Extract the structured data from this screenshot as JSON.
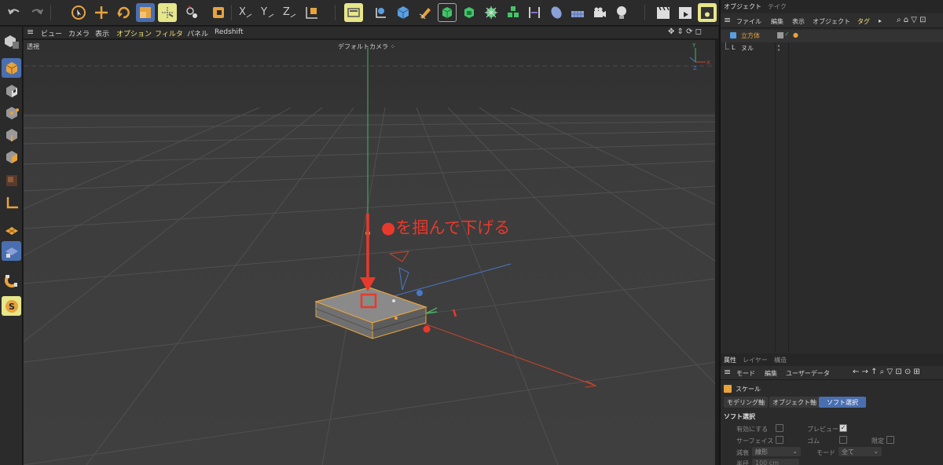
{
  "viewport_menu": {
    "items": [
      "ビュー",
      "カメラ",
      "表示",
      "オプション",
      "フィルタ",
      "パネル",
      "Redshift"
    ]
  },
  "viewport": {
    "projection": "透視",
    "camera": "デフォルトカメラ",
    "annotation": "●を掴んで下げる"
  },
  "object_manager": {
    "tabs": [
      "オブジェクト",
      "テイク"
    ],
    "menu": [
      "ファイル",
      "編集",
      "表示",
      "オブジェクト",
      "タグ"
    ],
    "objects": [
      "立方体",
      "ヌル"
    ]
  },
  "attribute_manager": {
    "tabs": [
      "属性",
      "レイヤー",
      "構造"
    ],
    "menu": [
      "モード",
      "編集",
      "ユーザーデータ"
    ],
    "tool_name": "スケール",
    "sub_tabs": [
      "モデリング軸",
      "オブジェクト軸",
      "ソフト選択"
    ],
    "section_title": "ソフト選択",
    "fields": {
      "enable": "有効にする",
      "preview": "プレビュー",
      "surface": "サーフェイス",
      "rubber": "ゴム",
      "restrict": "限定",
      "falloff_label": "減衰",
      "falloff_value": "線形",
      "mode_label": "モード",
      "mode_value": "全て",
      "radius_label": "半径",
      "radius_value": "100 cm"
    },
    "preview_checked": true
  },
  "colors": {
    "accent_yellow": "#f0e07a",
    "selected_blue": "#4a6fb0",
    "annotation_red": "#e8392c",
    "object_orange": "#e8a33d"
  }
}
